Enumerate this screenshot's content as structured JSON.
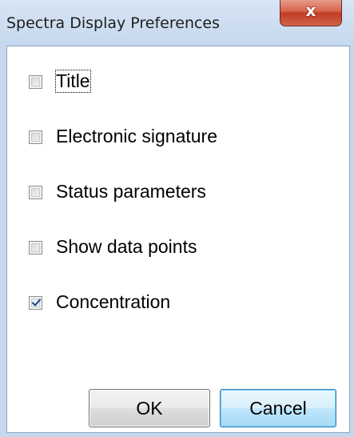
{
  "window": {
    "title": "Spectra Display Preferences",
    "close_glyph": "x"
  },
  "options": [
    {
      "label": "Title",
      "checked": false,
      "focused": true
    },
    {
      "label": "Electronic signature",
      "checked": false,
      "focused": false
    },
    {
      "label": "Status parameters",
      "checked": false,
      "focused": false
    },
    {
      "label": "Show data points",
      "checked": false,
      "focused": false
    },
    {
      "label": "Concentration",
      "checked": true,
      "focused": false
    }
  ],
  "buttons": {
    "ok_label": "OK",
    "cancel_label": "Cancel"
  },
  "colors": {
    "frame": "#c5d8ee",
    "close_button": "#d9664f",
    "check_mark": "#2a4f8c",
    "default_button_border": "#3c7fb1"
  },
  "icons": {
    "close": "close-icon",
    "check": "checkmark-icon"
  }
}
